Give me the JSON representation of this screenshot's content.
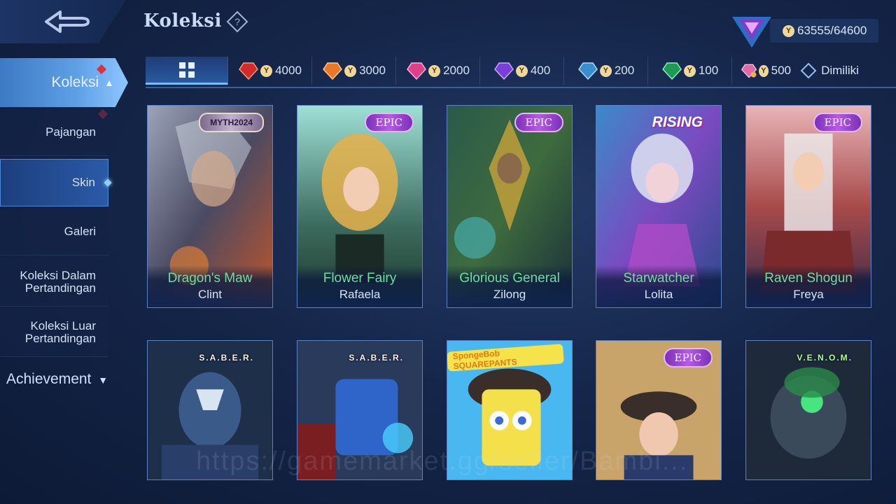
{
  "header": {
    "title": "Koleksi",
    "currency_value": "63555/64600"
  },
  "sidebar": {
    "main": "Koleksi",
    "items": [
      {
        "label": "Pajangan"
      },
      {
        "label": "Skin"
      },
      {
        "label": "Galeri"
      },
      {
        "label": "Koleksi Dalam Pertandingan"
      },
      {
        "label": "Koleksi Luar Pertandingan"
      }
    ],
    "achievement": "Achievement"
  },
  "filters": [
    {
      "price": "4000",
      "color": "#e03a3a"
    },
    {
      "price": "3000",
      "color": "#e8782a"
    },
    {
      "price": "2000",
      "color": "#e0408a"
    },
    {
      "price": "400",
      "color": "#8a4ee0"
    },
    {
      "price": "200",
      "color": "#4aa6e0"
    },
    {
      "price": "100",
      "color": "#2aa05a"
    },
    {
      "price": "500",
      "color": "#e06aa8"
    }
  ],
  "owned_label": "Dimiliki",
  "cards": [
    {
      "skin": "Dragon's Maw",
      "hero": "Clint",
      "badge": "MYTH2024"
    },
    {
      "skin": "Flower Fairy",
      "hero": "Rafaela",
      "badge": "EPIC"
    },
    {
      "skin": "Glorious General",
      "hero": "Zilong",
      "badge": "EPIC"
    },
    {
      "skin": "Starwatcher",
      "hero": "Lolita",
      "badge": "RISING"
    },
    {
      "skin": "Raven Shogun",
      "hero": "Freya",
      "badge": "EPIC"
    },
    {
      "skin": "",
      "hero": "",
      "badge": "S.A.B.E.R."
    },
    {
      "skin": "",
      "hero": "",
      "badge": "S.A.B.E.R."
    },
    {
      "skin": "",
      "hero": "",
      "badge": "SpongeBob SQUAREPANTS"
    },
    {
      "skin": "",
      "hero": "",
      "badge": "EPIC"
    },
    {
      "skin": "",
      "hero": "",
      "badge": "V.E.N.O.M."
    }
  ],
  "watermark": "https://gamemarket.gg/seller/Bambi..."
}
